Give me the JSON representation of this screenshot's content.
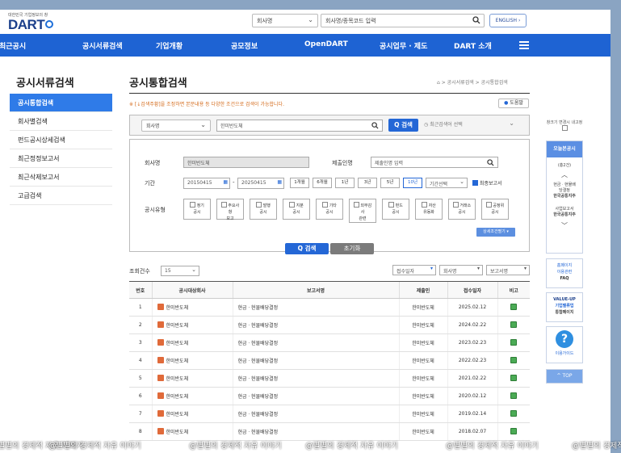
{
  "header": {
    "logo_sub": "대한민국 기업정보의 창",
    "logo": "DART",
    "company_select": "회사명",
    "search_placeholder": "회사명/종목코드 입력",
    "english_button": "ENGLISH"
  },
  "nav": {
    "items": [
      "최근공시",
      "공시서류검색",
      "기업개황",
      "공모정보",
      "OpenDART",
      "공시업무 · 제도",
      "DART 소개"
    ]
  },
  "sidebar": {
    "title": "공시서류검색",
    "items": [
      "공시통합검색",
      "회사별검색",
      "펀드공시상세검색",
      "최근정정보고서",
      "최근삭제보고서",
      "고급검색"
    ]
  },
  "main": {
    "title": "공시통합검색",
    "breadcrumb": "공시서류검색 > 공시통합검색",
    "notice": "※ [↓검색주황]을 조정하면 본문내용 등 다양한 조건으로 검색이 가능합니다.",
    "help_button": "도움말",
    "search": {
      "type_select": "회사명",
      "query": "한미반도체",
      "search_button": "검색",
      "recent_select": "최근검색어 선택"
    },
    "form": {
      "company_label": "회사명",
      "company_value": "한미반도체",
      "submitter_label": "제출인명",
      "submitter_placeholder": "제출인명 입력",
      "period_label": "기간",
      "date_from": "20150415",
      "date_to": "20250415",
      "period_buttons": [
        "1개월",
        "6개월",
        "1년",
        "3년",
        "5년",
        "10년"
      ],
      "period_select": "기간선택",
      "final_report_label": "최종보고서",
      "type_label": "공시유형",
      "types": [
        [
          "정기",
          "공시"
        ],
        [
          "주요사",
          "항",
          "보고"
        ],
        [
          "발행",
          "공시"
        ],
        [
          "지분",
          "공시"
        ],
        [
          "기타",
          "공시"
        ],
        [
          "외부감",
          "사",
          "관련"
        ],
        [
          "펀드",
          "공시"
        ],
        [
          "자산",
          "유동화"
        ],
        [
          "거래소",
          "공시"
        ],
        [
          "공정위",
          "공시"
        ]
      ],
      "detail_button": "상세조건펼기",
      "search_button": "검색",
      "reset_button": "초기화"
    },
    "results": {
      "count_label": "조회건수",
      "count_value": "15",
      "sort_select": "접수일자",
      "sort2_select": "회사명",
      "sort3_select": "보고서명",
      "columns": [
        "번호",
        "공시대상회사",
        "보고서명",
        "제출인",
        "접수일자",
        "비고"
      ],
      "rows": [
        [
          "1",
          "한미반도체",
          "현금ㆍ현물배당결정",
          "한미반도체",
          "2025.02.12"
        ],
        [
          "2",
          "한미반도체",
          "현금ㆍ현물배당결정",
          "한미반도체",
          "2024.02.22"
        ],
        [
          "3",
          "한미반도체",
          "현금ㆍ현물배당결정",
          "한미반도체",
          "2023.02.23"
        ],
        [
          "4",
          "한미반도체",
          "현금ㆍ현물배당결정",
          "한미반도체",
          "2022.02.23"
        ],
        [
          "5",
          "한미반도체",
          "현금ㆍ현물배당결정",
          "한미반도체",
          "2021.02.22"
        ],
        [
          "6",
          "한미반도체",
          "현금ㆍ현물배당결정",
          "한미반도체",
          "2020.02.12"
        ],
        [
          "7",
          "한미반도체",
          "현금ㆍ현물배당결정",
          "한미반도체",
          "2019.02.14"
        ],
        [
          "8",
          "한미반도체",
          "현금ㆍ현물배당결정",
          "한미반도체",
          "2018.02.07"
        ]
      ]
    }
  },
  "rail": {
    "window_label": "창크기 변경시 내고정",
    "today_head": "오늘본공시",
    "today_count": "(총2건)",
    "today_item1": [
      "현금ㆍ현물배",
      "당결정",
      "한국공통지주"
    ],
    "today_item2": [
      "사업보고서",
      "한국공통지주"
    ],
    "homepage": [
      "홈페이지",
      "이용관련",
      "FAQ"
    ],
    "valueup": [
      "VALUE-UP",
      "기업밸류업",
      "통합페이지"
    ],
    "guide_label": "이용가이드",
    "top_label": "TOP"
  },
  "watermark": "@별별의 경제적 자유 이야기"
}
